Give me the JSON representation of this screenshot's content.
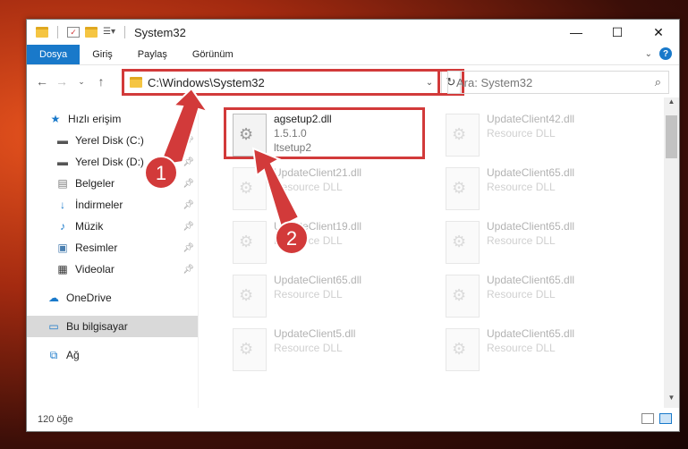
{
  "window": {
    "title": "System32",
    "controls": [
      "minimize-icon",
      "maximize-icon",
      "close-icon"
    ]
  },
  "ribbon": {
    "tabs": [
      {
        "label": "Dosya",
        "active": true
      },
      {
        "label": "Giriş",
        "active": false
      },
      {
        "label": "Paylaş",
        "active": false
      },
      {
        "label": "Görünüm",
        "active": false
      }
    ],
    "help": "?"
  },
  "address": {
    "path": "C:\\Windows\\System32",
    "search_placeholder": "Ara: System32"
  },
  "nav": {
    "items": [
      {
        "label": "Hızlı erişim",
        "icon": "star-icon"
      },
      {
        "label": "Yerel Disk (C:)",
        "icon": "drive-icon",
        "pinned": true
      },
      {
        "label": "Yerel Disk (D:)",
        "icon": "drive-icon",
        "pinned": true
      },
      {
        "label": "Belgeler",
        "icon": "documents-icon",
        "pinned": true
      },
      {
        "label": "İndirmeler",
        "icon": "download-icon",
        "pinned": true
      },
      {
        "label": "Müzik",
        "icon": "music-icon",
        "pinned": true
      },
      {
        "label": "Resimler",
        "icon": "pictures-icon",
        "pinned": true
      },
      {
        "label": "Videolar",
        "icon": "videos-icon",
        "pinned": true
      },
      {
        "label": "OneDrive",
        "icon": "cloud-icon"
      },
      {
        "label": "Bu bilgisayar",
        "icon": "computer-icon",
        "selected": true
      },
      {
        "label": "Ağ",
        "icon": "network-icon"
      }
    ]
  },
  "files": [
    {
      "name": "agsetup2.dll",
      "line2": "1.5.1.0",
      "line3": "ltsetup2"
    },
    {
      "name": "UpdateClient42.dll",
      "line2": "Resource DLL"
    },
    {
      "name": "UpdateClient21.dll",
      "line2": "Resource DLL"
    },
    {
      "name": "UpdateClient65.dll",
      "line2": "Resource DLL"
    },
    {
      "name": "UpdateClient19.dll",
      "line2": "Resource DLL"
    },
    {
      "name": "UpdateClient65.dll",
      "line2": "Resource DLL"
    },
    {
      "name": "UpdateClient65.dll",
      "line2": "Resource DLL"
    },
    {
      "name": "UpdateClient65.dll",
      "line2": "Resource DLL"
    },
    {
      "name": "UpdateClient5.dll",
      "line2": "Resource DLL"
    },
    {
      "name": "UpdateClient65.dll",
      "line2": "Resource DLL"
    }
  ],
  "status": {
    "count": "120 öğe"
  },
  "annotations": {
    "step1": "1",
    "step2": "2",
    "highlight_color": "#d23a3a"
  }
}
